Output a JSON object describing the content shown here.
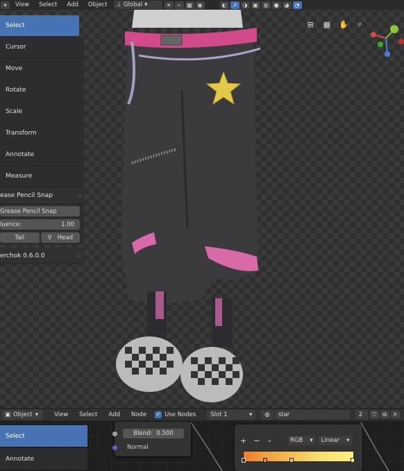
{
  "header": {
    "menus": [
      "View",
      "Select",
      "Add",
      "Object"
    ],
    "orientation": "Global"
  },
  "toolbar": {
    "items": [
      {
        "label": "Select",
        "active": true
      },
      {
        "label": "Cursor"
      },
      {
        "label": "Move"
      },
      {
        "label": "Rotate"
      },
      {
        "label": "Scale"
      },
      {
        "label": "Transform"
      },
      {
        "label": "Annotate"
      },
      {
        "label": "Measure"
      }
    ]
  },
  "grease_panel": {
    "title": "ease Pencil Snap",
    "button": "Grease Pencil Snap",
    "influence_label": "luence:",
    "influence_value": "1.00",
    "tail": "Tail",
    "head": "Head"
  },
  "sverchok_panel": {
    "title": "erchok 0.6.0.0"
  },
  "node_editor": {
    "object_mode": "Object",
    "menus": [
      "View",
      "Select",
      "Add",
      "Node"
    ],
    "use_nodes_label": "Use Nodes",
    "slot": "Slot 1",
    "material": "star",
    "users": "2",
    "tools": [
      "Select",
      "Annotate"
    ],
    "blend_label": "Blend:",
    "blend_value": "0.500",
    "normal_label": "Normal",
    "ramp_color_mode": "RGB",
    "ramp_interpolation": "Linear"
  },
  "colors": {
    "accent": "#4772b3",
    "panel": "#2d2d2d"
  }
}
